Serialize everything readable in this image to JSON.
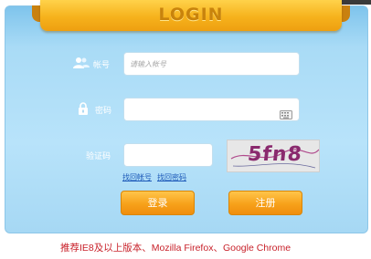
{
  "header": {
    "title": "LOGIN"
  },
  "form": {
    "account": {
      "label": "帐号",
      "placeholder": "请输入帐号"
    },
    "password": {
      "label": "密码",
      "placeholder": ""
    },
    "captcha": {
      "label": "验证码",
      "value": "",
      "image_text": "5fn8"
    }
  },
  "links": {
    "retrieve_account": "找回帐号",
    "retrieve_password": "找回密码"
  },
  "buttons": {
    "login": "登录",
    "register": "注册"
  },
  "footer": {
    "note": "推荐IE8及以上版本、Mozilla Firefox、Google Chrome"
  },
  "colors": {
    "banner": "#f6b21c",
    "panel": "#b8e3fa",
    "button": "#f7a11a",
    "footer_text": "#c8212a",
    "link": "#1b58b8"
  }
}
